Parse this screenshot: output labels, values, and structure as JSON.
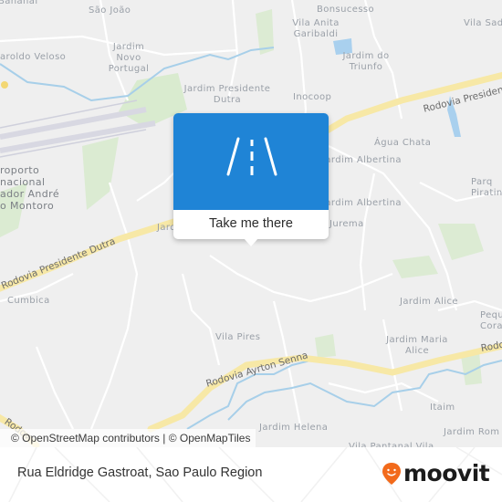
{
  "map": {
    "places": [
      {
        "name": "Bananal",
        "label": "Bananal"
      },
      {
        "name": "sao-joao",
        "label": "São João"
      },
      {
        "name": "bonsucesso",
        "label": "Bonsucesso"
      },
      {
        "name": "vila-anita-garibaldi",
        "label": "Vila Anita Garibaldi"
      },
      {
        "name": "vila-sa",
        "label": "Vila Sad"
      },
      {
        "name": "jardim-novo-portugal",
        "label": "Jardim Novo Portugal"
      },
      {
        "name": "haroldo-veloso",
        "label": "aroldo Veloso"
      },
      {
        "name": "jardim-do-triunfo",
        "label": "Jardim do Triunfo"
      },
      {
        "name": "jardim-presidente-dutra",
        "label": "Jardim Presidente Dutra"
      },
      {
        "name": "inocoop",
        "label": "Inocoop"
      },
      {
        "name": "agua-chata",
        "label": "Água Chata"
      },
      {
        "name": "jardim-albertina-1",
        "label": "Jardim Albertina"
      },
      {
        "name": "jardim-albertina-2",
        "label": "Jardim Albertina"
      },
      {
        "name": "jurema",
        "label": "Jurema"
      },
      {
        "name": "jardim-partial",
        "label": "Jard"
      },
      {
        "name": "parque-piratininga",
        "label": "Parq Piratin"
      },
      {
        "name": "aeroporto",
        "label": "roporto\nnacional\nador André\no Montoro"
      },
      {
        "name": "cumbica",
        "label": "Cumbica"
      },
      {
        "name": "jardim-alice",
        "label": "Jardim Alice"
      },
      {
        "name": "pequeno-coracao",
        "label": "Pequ Cora"
      },
      {
        "name": "jardim-maria-alice",
        "label": "Jardim Maria Alice"
      },
      {
        "name": "vila-pires",
        "label": "Vila Pires"
      },
      {
        "name": "itaim",
        "label": "Itaim"
      },
      {
        "name": "jardim-helena",
        "label": "Jardim Helena"
      },
      {
        "name": "jardim-romano",
        "label": "Jardim Rom"
      },
      {
        "name": "vila-bartolomeu",
        "label": "Vila Pantanal   Vila"
      }
    ],
    "roads": [
      {
        "name": "rodovia-presidente-dutra-east",
        "label": "Rodovia Presiden"
      },
      {
        "name": "rodovia-presidente-dutra-west",
        "label": "Rodovia Presidente Dutra"
      },
      {
        "name": "rodovia-ayrton-senna",
        "label": "Rodovia Ayrton Senna"
      },
      {
        "name": "rodovia-east",
        "label": "Rodo"
      },
      {
        "name": "rodovia-southwest",
        "label": "Rodov"
      }
    ],
    "attribution": "© OpenStreetMap contributors | © OpenMapTiles"
  },
  "popup": {
    "icon": "road-icon",
    "cta_label": "Take me there",
    "banner_color": "#1f84d6"
  },
  "footer": {
    "address": "Rua Eldridge Gastroat, Sao Paulo Region",
    "brand": "moovit",
    "brand_color": "#f26a1b"
  }
}
